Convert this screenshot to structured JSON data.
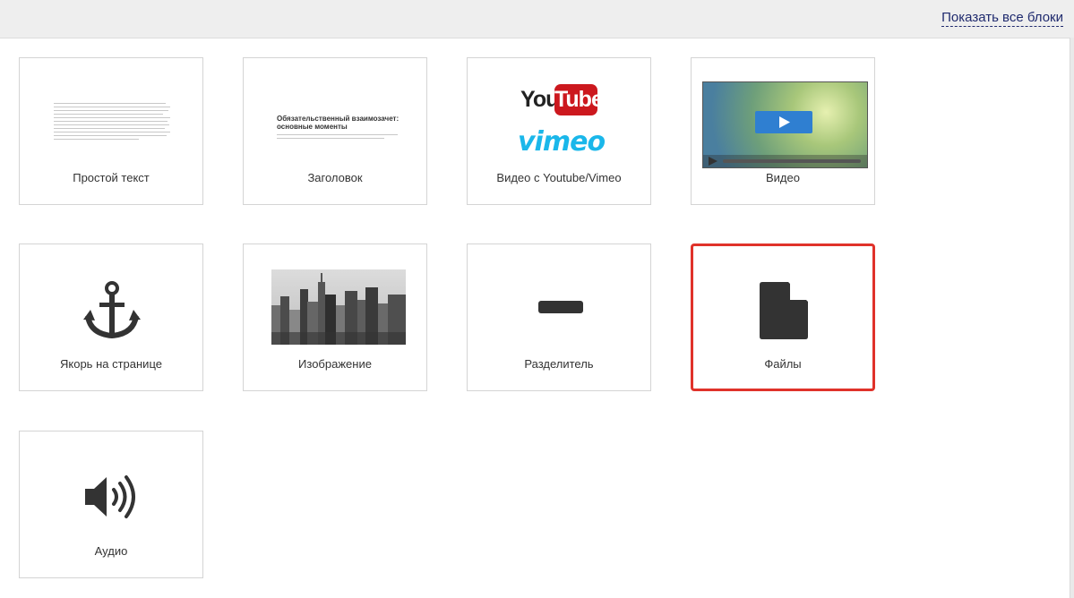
{
  "header": {
    "show_all": "Показать все блоки"
  },
  "blocks": [
    {
      "label": "Простой текст"
    },
    {
      "label": "Заголовок",
      "preview_title_1": "Обязательственный взаимозачет:",
      "preview_title_2": "основные моменты"
    },
    {
      "label": "Видео с Youtube/Vimeo",
      "logo_1": "You",
      "logo_1b": "Tube",
      "logo_2": "vimeo"
    },
    {
      "label": "Видео"
    },
    {
      "label": "Якорь на странице",
      "icon": "anchor-icon"
    },
    {
      "label": "Изображение"
    },
    {
      "label": "Разделитель",
      "icon": "divider-icon"
    },
    {
      "label": "Файлы",
      "icon": "file-icon",
      "selected": true
    },
    {
      "label": "Аудио",
      "icon": "speaker-icon"
    }
  ],
  "colors": {
    "selected_border": "#e0322a",
    "header_link": "#1f2a6e",
    "icon": "#333333"
  }
}
